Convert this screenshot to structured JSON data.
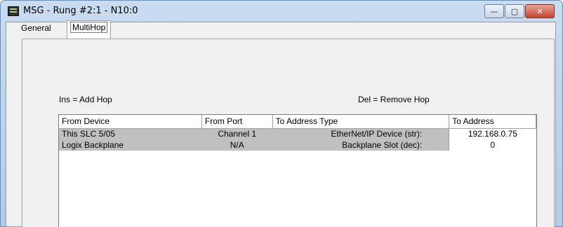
{
  "window": {
    "title": "MSG - Rung #2:1 - N10:0",
    "icon": "msg-app-icon",
    "controls": {
      "minimize": "—",
      "maximize": "▢",
      "close": "✕"
    }
  },
  "tabs": [
    {
      "label": "General",
      "active": false
    },
    {
      "label": "MultiHop",
      "active": true
    }
  ],
  "hints": {
    "ins": "Ins = Add Hop",
    "del": "Del = Remove Hop"
  },
  "table": {
    "columns": [
      "From Device",
      "From Port",
      "To Address Type",
      "To Address"
    ],
    "rows": [
      {
        "from_device": "This SLC 5/05",
        "from_port": "Channel  1",
        "to_address_type": "EtherNet/IP Device (str):",
        "to_address": "192.168.0.75"
      },
      {
        "from_device": "Logix Backplane",
        "from_port": "N/A",
        "to_address_type": "Backplane Slot (dec):",
        "to_address": "0"
      }
    ]
  }
}
